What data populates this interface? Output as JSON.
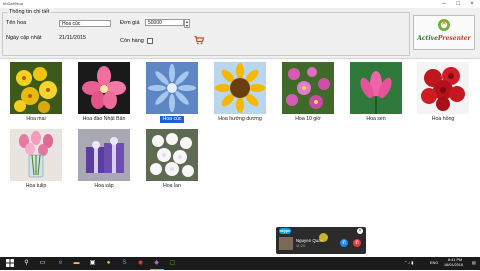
{
  "window": {
    "title": "bhDaHHoa"
  },
  "details": {
    "group_title": "Thông tin chi tiết",
    "name_label": "Tên hoa",
    "name_value": "Hoa cúc",
    "price_label": "Đơn giá",
    "price_value": "50000",
    "date_label": "Ngày cập nhật",
    "date_value": "21/11/2015",
    "stock_label": "Còn hàng",
    "in_stock": false
  },
  "watermark": {
    "brand_a": "Active",
    "brand_b": "Presenter"
  },
  "flowers": [
    {
      "name": "Hoa mai",
      "selected": false,
      "icon": "yellow-apricot-blossom"
    },
    {
      "name": "Hoa đào Nhật Bản",
      "selected": false,
      "icon": "pink-cherry-blossom"
    },
    {
      "name": "Hoa cúc",
      "selected": true,
      "icon": "blue-daisy"
    },
    {
      "name": "Hoa hướng dương",
      "selected": false,
      "icon": "sunflower"
    },
    {
      "name": "Hoa 10 giờ",
      "selected": false,
      "icon": "pink-moss-rose"
    },
    {
      "name": "Hoa sen",
      "selected": false,
      "icon": "pink-lotus"
    },
    {
      "name": "Hoa hồng",
      "selected": false,
      "icon": "red-roses"
    },
    {
      "name": "Hoa tulip",
      "selected": false,
      "icon": "tulip-bouquet"
    },
    {
      "name": "Hoa sáp",
      "selected": false,
      "icon": "purple-gift-boxes"
    },
    {
      "name": "Hoa lan",
      "selected": false,
      "icon": "white-orchids"
    }
  ],
  "skype": {
    "logo": "skype",
    "caller": "Nguyen Quan",
    "time": "11:24",
    "close": "×"
  },
  "taskbar": {
    "language": "ENG",
    "clock_time": "8:41 PM",
    "clock_date": "16/01/2016"
  },
  "colors": {
    "selection": "#1e5fd8",
    "skype_blue": "#00a7e7",
    "accept": "#1e88e5",
    "decline": "#e53935"
  }
}
